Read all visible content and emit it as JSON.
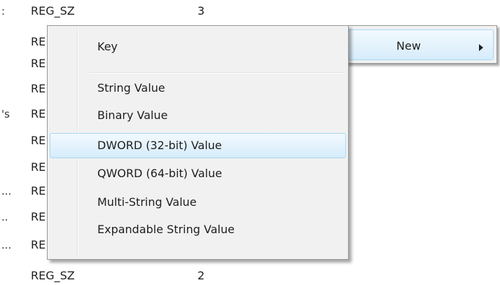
{
  "registry_list": {
    "rows": [
      {
        "lead": ":",
        "type": "REG_SZ",
        "data": "3"
      },
      {
        "lead": "",
        "type": "RE",
        "data": ""
      },
      {
        "lead": "",
        "type": "RE",
        "data": ""
      },
      {
        "lead": "",
        "type": "RE",
        "data": ""
      },
      {
        "lead": "'s",
        "type": "RE",
        "data": ""
      },
      {
        "lead": "",
        "type": "RE",
        "data": ""
      },
      {
        "lead": "",
        "type": "RE",
        "data": ""
      },
      {
        "lead": "...",
        "type": "RE",
        "data": ""
      },
      {
        "lead": "..",
        "type": "RE",
        "data": ""
      },
      {
        "lead": "...",
        "type": "RE",
        "data": ""
      },
      {
        "lead": "",
        "type": "REG_SZ",
        "data": "2"
      }
    ]
  },
  "parent_menu": {
    "label": "New",
    "arrow_icon": "chevron-right-icon"
  },
  "submenu": {
    "items": [
      {
        "label": "Key"
      },
      {
        "label": "String Value"
      },
      {
        "label": "Binary Value"
      },
      {
        "label": "DWORD (32-bit) Value",
        "highlighted": true
      },
      {
        "label": "QWORD (64-bit) Value"
      },
      {
        "label": "Multi-String Value"
      },
      {
        "label": "Expandable String Value"
      }
    ]
  },
  "colors": {
    "menu_background": "#f1f1f1",
    "menu_border": "#979797",
    "highlight_border": "#a8d8f5",
    "highlight_fill": "#d6ecfb"
  }
}
